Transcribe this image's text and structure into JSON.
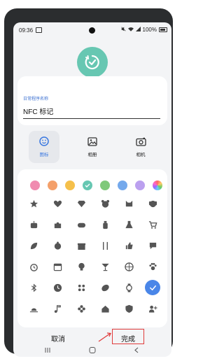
{
  "status": {
    "time": "09:36",
    "battery": "100%",
    "icons": [
      "image-icon",
      "mute-icon",
      "wifi-icon",
      "signal-icon",
      "battery-icon"
    ]
  },
  "app_icon": "check-badge-icon",
  "name_field": {
    "label": "日常程序名称",
    "value": "NFC 标记"
  },
  "icon_types": [
    {
      "label": "图标",
      "icon": "smiley-icon",
      "active": true
    },
    {
      "label": "相册",
      "icon": "gallery-icon",
      "active": false
    },
    {
      "label": "相机",
      "icon": "camera-icon",
      "active": false
    }
  ],
  "colors": [
    {
      "hex": "#f08bb0",
      "selected": false
    },
    {
      "hex": "#f4a06a",
      "selected": false
    },
    {
      "hex": "#f5c04b",
      "selected": false
    },
    {
      "hex": "#67c7b2",
      "selected": true
    },
    {
      "hex": "#7fc97a",
      "selected": false
    },
    {
      "hex": "#74a9ec",
      "selected": false
    },
    {
      "hex": "#bba0ef",
      "selected": false
    },
    {
      "hex": "rainbow",
      "selected": false
    }
  ],
  "icons": [
    [
      "star-icon",
      "heart-icon",
      "diamond-icon",
      "bear-icon",
      "cat-icon",
      "dog-icon"
    ],
    [
      "robot-icon",
      "puzzle-icon",
      "gamepad-icon",
      "bottle-icon",
      "flask-icon",
      "cart-icon"
    ],
    [
      "leaf-icon",
      "baby-icon",
      "gift-icon",
      "cutlery-icon",
      "thumbs-up-icon",
      "chat-icon"
    ],
    [
      "alarm-icon",
      "calendar-icon",
      "bulb-icon",
      "cocktail-icon",
      "basketball-icon",
      "paw-icon"
    ],
    [
      "bluetooth-icon",
      "clock-icon",
      "apps-icon",
      "bean-icon",
      "watch-icon",
      "check-icon"
    ],
    [
      "sunrise-icon",
      "music-icon",
      "flower-icon",
      "home-icon",
      "shield-icon",
      "person-plus-icon"
    ]
  ],
  "selected_icon": "check-icon",
  "buttons": {
    "cancel": "取消",
    "done": "完成"
  },
  "nav": [
    "recents-icon",
    "home-icon",
    "back-icon"
  ]
}
